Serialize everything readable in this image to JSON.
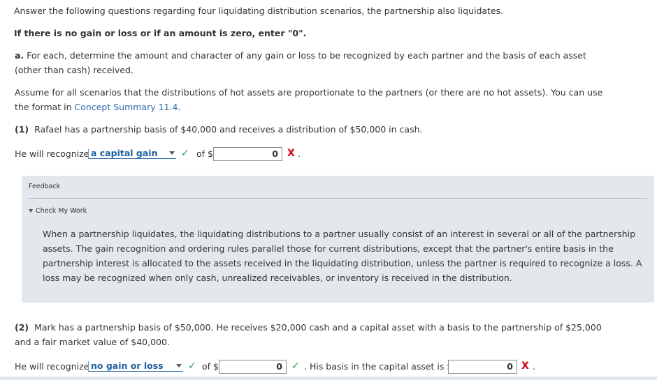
{
  "intro": "Answer the following questions regarding four liquidating distribution scenarios, the partnership also liquidates.",
  "zero_instruction": "If there is no gain or loss or if an amount is zero, enter \"0\".",
  "part_a": {
    "label": "a.",
    "text": "For each, determine the amount and character of any gain or loss to be recognized by each partner and the basis of each asset (other than cash) received."
  },
  "assume": {
    "text": "Assume for all scenarios that the distributions of hot assets are proportionate to the partners (or there are no hot assets). You can use the format in ",
    "link": "Concept Summary 11.4",
    "tail": "."
  },
  "q1": {
    "label": "(1)",
    "text": "Rafael has a partnership basis of $40,000 and receives a distribution of $50,000 in cash.",
    "prefix": "He will recognize",
    "selected": "a capital gain",
    "of_label": "of $",
    "amount": "0",
    "period": "."
  },
  "feedback": {
    "title": "Feedback",
    "toggle": "Check My Work",
    "body": "When a partnership liquidates, the liquidating distributions to a partner usually consist of an interest in several or all of the partnership assets. The gain recognition and ordering rules parallel those for current distributions, except that the partner's entire basis in the partnership interest is allocated to the assets received in the liquidating distribution, unless the partner is required to recognize a loss. A loss may be recognized when only cash, unrealized receivables, or inventory is received in the distribution."
  },
  "q2": {
    "label": "(2)",
    "text": "Mark has a partnership basis of $50,000. He receives $20,000 cash and a capital asset with a basis to the partnership of $25,000 and a fair market value of $40,000.",
    "prefix": "He will recognize",
    "selected": "no gain or loss",
    "of_label": "of $",
    "amount": "0",
    "basis_label": ". His basis in the capital asset is $",
    "basis_amount": "0",
    "period": "."
  },
  "icons": {
    "check": "✓",
    "x": "X",
    "check_color": "#2e9b3a",
    "x_color": "#d0021b"
  }
}
